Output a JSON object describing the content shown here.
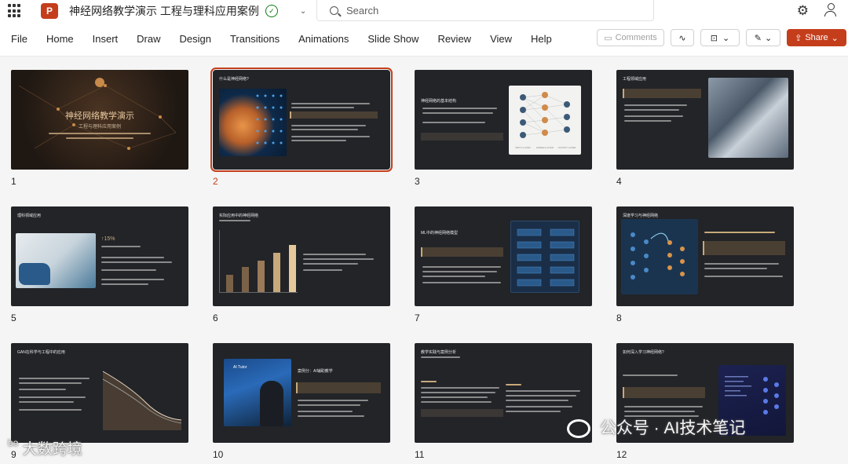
{
  "titlebar": {
    "app_icon": "P",
    "doc_title": "神经网络教学演示 工程与理科应用案例",
    "search_placeholder": "Search",
    "icons": [
      "waffle-icon",
      "saved-cloud-icon",
      "chevron-down-icon",
      "search-icon",
      "gear-icon",
      "person-icon"
    ]
  },
  "ribbon": {
    "tabs": [
      "File",
      "Home",
      "Insert",
      "Draw",
      "Design",
      "Transitions",
      "Animations",
      "Slide Show",
      "Review",
      "View",
      "Help"
    ],
    "comments_label": "Comments",
    "share_label": "Share"
  },
  "slides": [
    {
      "num": "1",
      "title": "神经网络教学演示",
      "subtitle": "工程与理科应用案例"
    },
    {
      "num": "2",
      "title": "什么是神经网络?"
    },
    {
      "num": "3",
      "title": "神经网络的基本结构",
      "diagram_labels": [
        "INPUT LAYER",
        "HIDDEN LAYER",
        "OUTPUT LAYER"
      ]
    },
    {
      "num": "4",
      "title": "工程领域应用"
    },
    {
      "num": "5",
      "title": "理科领域应用",
      "stat": "↑15%"
    },
    {
      "num": "6",
      "title": "实际应用中的神经网络"
    },
    {
      "num": "7",
      "title": "ML中的神经网络模型"
    },
    {
      "num": "8",
      "title": "深度学习与神经网络"
    },
    {
      "num": "9",
      "title": "GAN在科学与工程中的应用"
    },
    {
      "num": "10",
      "title": "案例分：AI辅助教学",
      "image_text": "AI Tutor"
    },
    {
      "num": "11",
      "title": "教学实践与案例分析"
    },
    {
      "num": "12",
      "title": "如何深入学习神经网络?"
    }
  ],
  "selected_slide": 2,
  "watermarks": {
    "left": "大数跨境",
    "right": "公众号 · AI技术笔记"
  },
  "colors": {
    "accent": "#c43e1c",
    "slide_bg": "#222428",
    "gold": "#c8a97a"
  }
}
